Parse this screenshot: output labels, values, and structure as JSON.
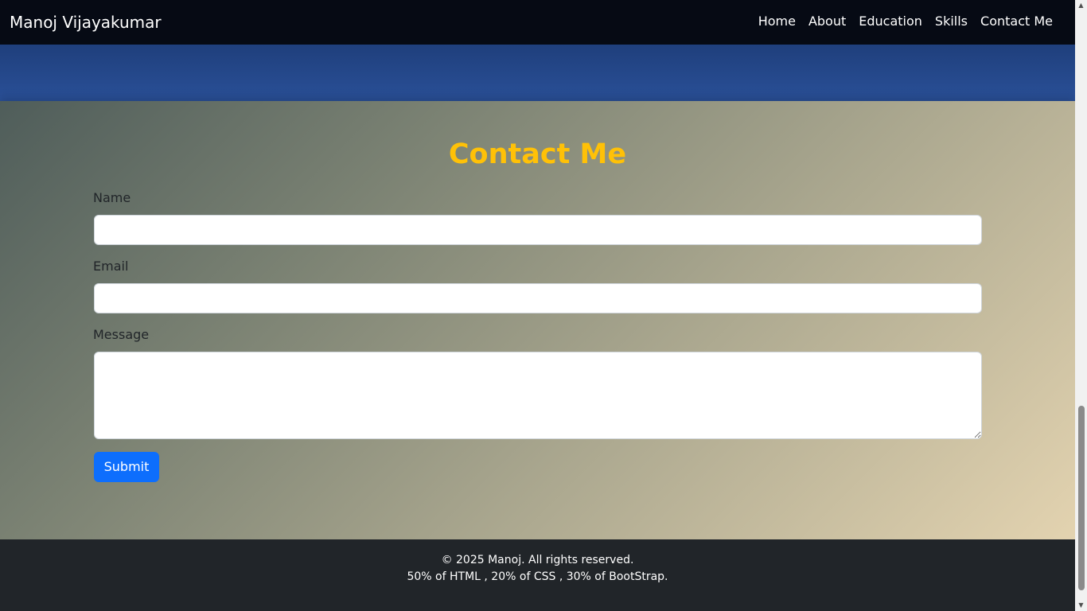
{
  "navbar": {
    "brand": "Manoj Vijayakumar",
    "links": [
      "Home",
      "About",
      "Education",
      "Skills",
      "Contact Me"
    ]
  },
  "contact": {
    "title": "Contact Me",
    "name_label": "Name",
    "name_value": "",
    "email_label": "Email",
    "email_value": "",
    "message_label": "Message",
    "message_value": "",
    "submit_label": "Submit"
  },
  "footer": {
    "copyright": "© 2025 Manoj. All rights reserved.",
    "tech": "50% of HTML , 20% of CSS , 30% of BootStrap."
  },
  "colors": {
    "navbar_bg": "#060a14",
    "title_color": "#ffc107",
    "button_color": "#0d6efd",
    "footer_bg": "#212529"
  },
  "icons": {
    "scroll_up": "scroll-up-arrow-icon",
    "scroll_down": "scroll-down-arrow-icon"
  }
}
